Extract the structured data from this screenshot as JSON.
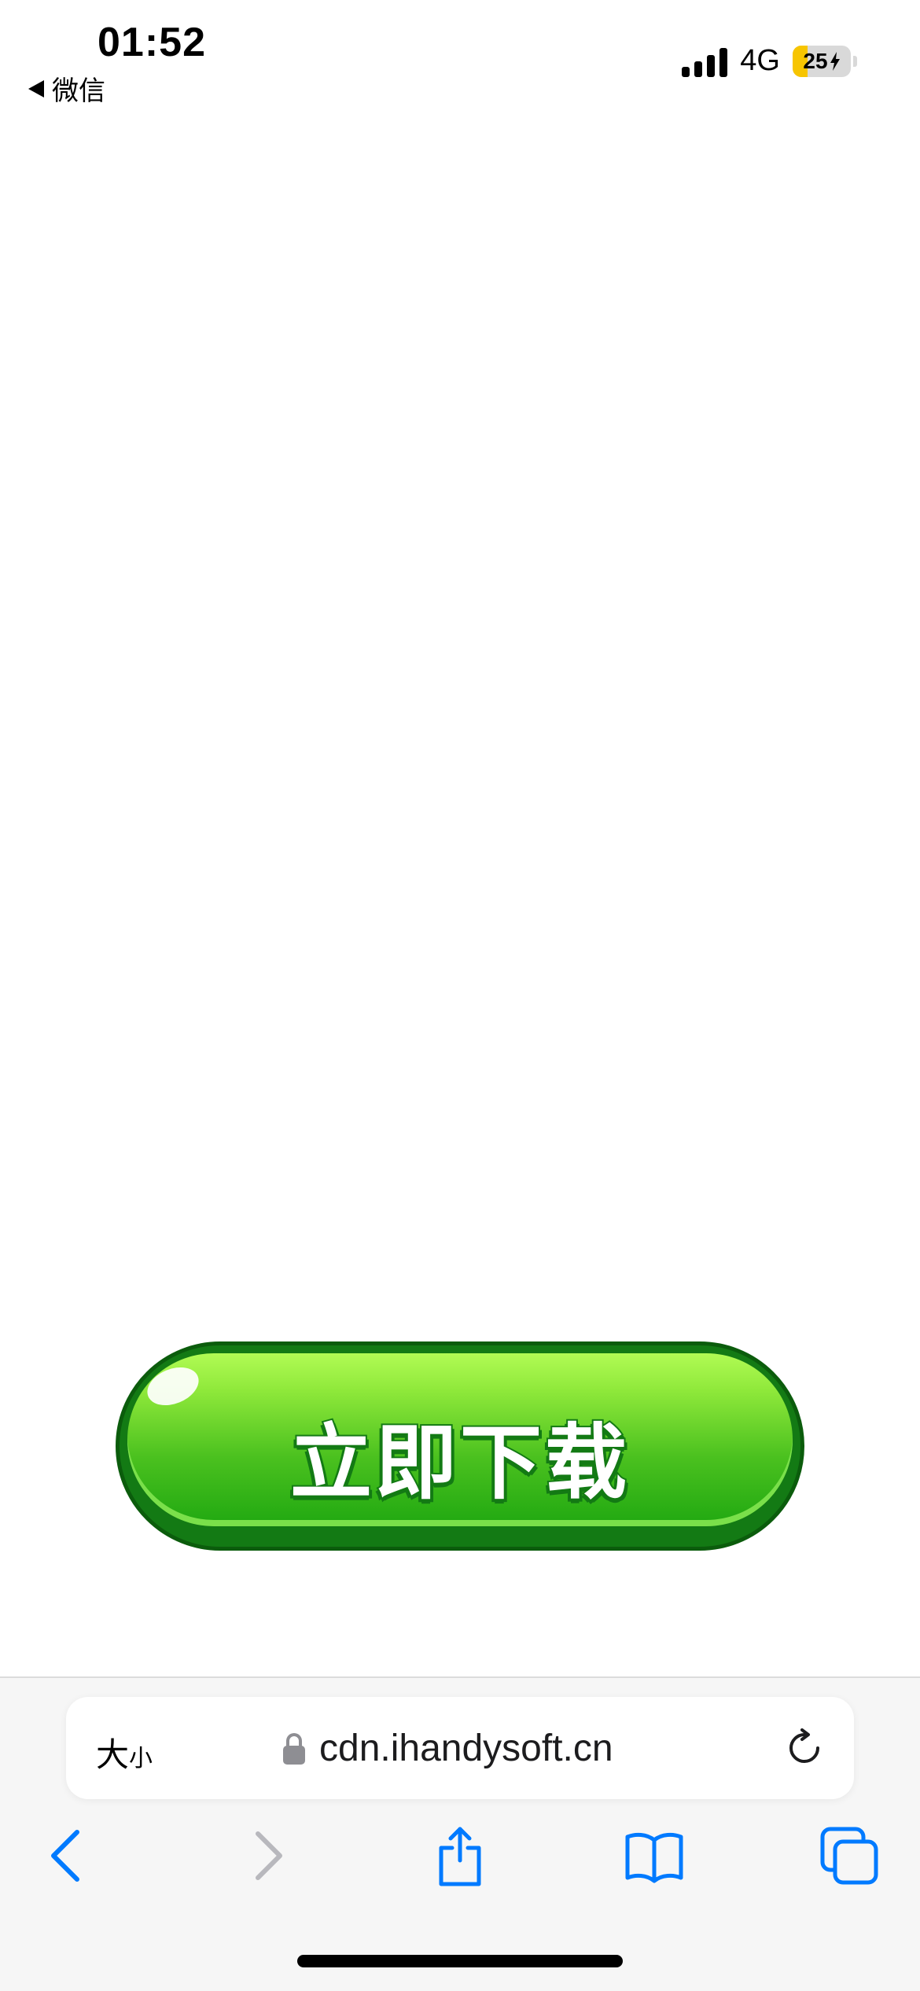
{
  "status_bar": {
    "time": "01:52",
    "back_app": "微信",
    "network": "4G",
    "battery_percent": 25,
    "battery_label": "25",
    "battery_fill_color": "#f7c500",
    "charging_icon": "bolt-icon"
  },
  "main": {
    "download_button_label": "立即下载",
    "button_color": "#2db61a",
    "button_dark_color": "#137a14"
  },
  "browser": {
    "text_size_label_big": "大",
    "text_size_label_small": "小",
    "url": "cdn.ihandysoft.cn",
    "lock_icon": "lock-icon",
    "reload_icon": "reload-icon",
    "toolbar_icons": [
      "back-icon",
      "forward-icon",
      "share-icon",
      "bookmarks-icon",
      "tabs-icon"
    ],
    "accent_color": "#007aff",
    "disabled_color": "#b8b8bd"
  }
}
